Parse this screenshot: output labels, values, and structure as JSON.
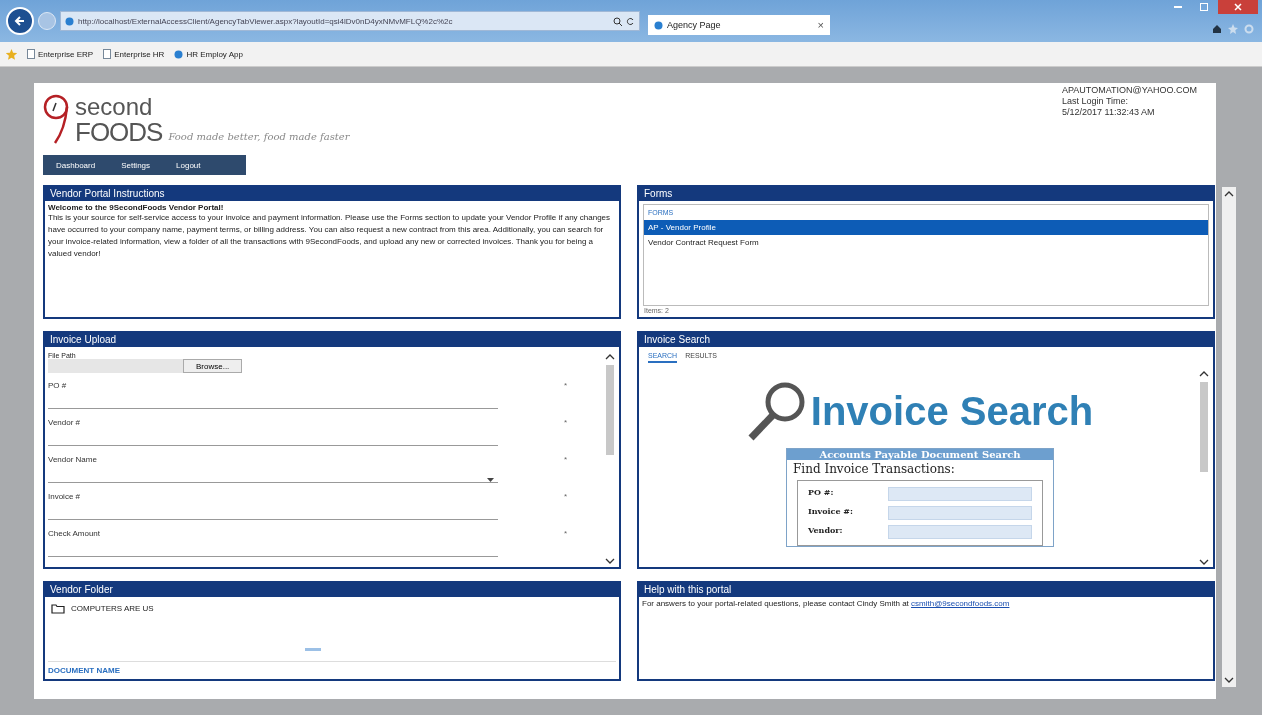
{
  "browser": {
    "url": "http://localhost/ExternalAccessClient/AgencyTabViewer.aspx?layoutId=qsi4lDv0nD4yxNMvMFLQ%2c%2c",
    "tab_title": "Agency Page",
    "tab_close": "×",
    "favorites": [
      {
        "label": "Enterprise ERP",
        "kind": "page"
      },
      {
        "label": "Enterprise HR",
        "kind": "page"
      },
      {
        "label": "HR Employ App",
        "kind": "site"
      }
    ]
  },
  "header": {
    "logo_top": "second",
    "logo_bottom": "FOODS",
    "tagline": "Food made better, food made faster",
    "user_email": "APAUTOMATION@YAHOO.COM",
    "login_label": "Last Login Time:",
    "login_time": "5/12/2017 11:32:43 AM",
    "nav": [
      {
        "label": "Dashboard"
      },
      {
        "label": "Settings"
      },
      {
        "label": "Logout"
      }
    ]
  },
  "instructions": {
    "title": "Vendor Portal Instructions",
    "heading": "Welcome to the 9SecondFoods Vendor Portal!",
    "body": "This is your source for self-service access to your invoice and payment information.  Please use the Forms section to update your Vendor Profile if any changes have occurred to your company name, payment terms, or billing address.  You can also request a new contract from this area.  Additionally, you can search for your invoice-related information, view a folder of all the transactions with 9SecondFoods, and upload any new or corrected invoices.  Thank you for being a valued vendor!"
  },
  "forms": {
    "title": "Forms",
    "column": "FORMS",
    "items": [
      {
        "label": "AP - Vendor Profile",
        "selected": true
      },
      {
        "label": "Vendor Contract Request Form",
        "selected": false
      }
    ],
    "footer": "Items: 2"
  },
  "upload": {
    "title": "Invoice Upload",
    "file_label": "File Path",
    "browse": "Browse...",
    "fields": [
      {
        "label": "PO #",
        "kind": "text",
        "mark": "*"
      },
      {
        "label": "Vendor #",
        "kind": "text",
        "mark": "*"
      },
      {
        "label": "Vendor Name",
        "kind": "select",
        "mark": "*"
      },
      {
        "label": "Invoice #",
        "kind": "text",
        "mark": "*"
      },
      {
        "label": "Check Amount",
        "kind": "text",
        "mark": "*"
      }
    ]
  },
  "search": {
    "title": "Invoice Search",
    "tabs": [
      {
        "label": "SEARCH",
        "selected": true
      },
      {
        "label": "RESULTS",
        "selected": false
      }
    ],
    "banner": "Invoice Search",
    "form_title": "Accounts Payable Document Search",
    "form_heading": "Find Invoice Transactions:",
    "form_fields": [
      {
        "label": "PO #:"
      },
      {
        "label": "Invoice #:"
      },
      {
        "label": "Vendor:"
      }
    ]
  },
  "folder": {
    "title": "Vendor Folder",
    "folder_name": "COMPUTERS ARE US",
    "column": "DOCUMENT NAME"
  },
  "help": {
    "title": "Help with this portal",
    "text": "For answers to your portal-related questions, please contact Cindy Smith at ",
    "link": "csmith@9secondfoods.com"
  }
}
